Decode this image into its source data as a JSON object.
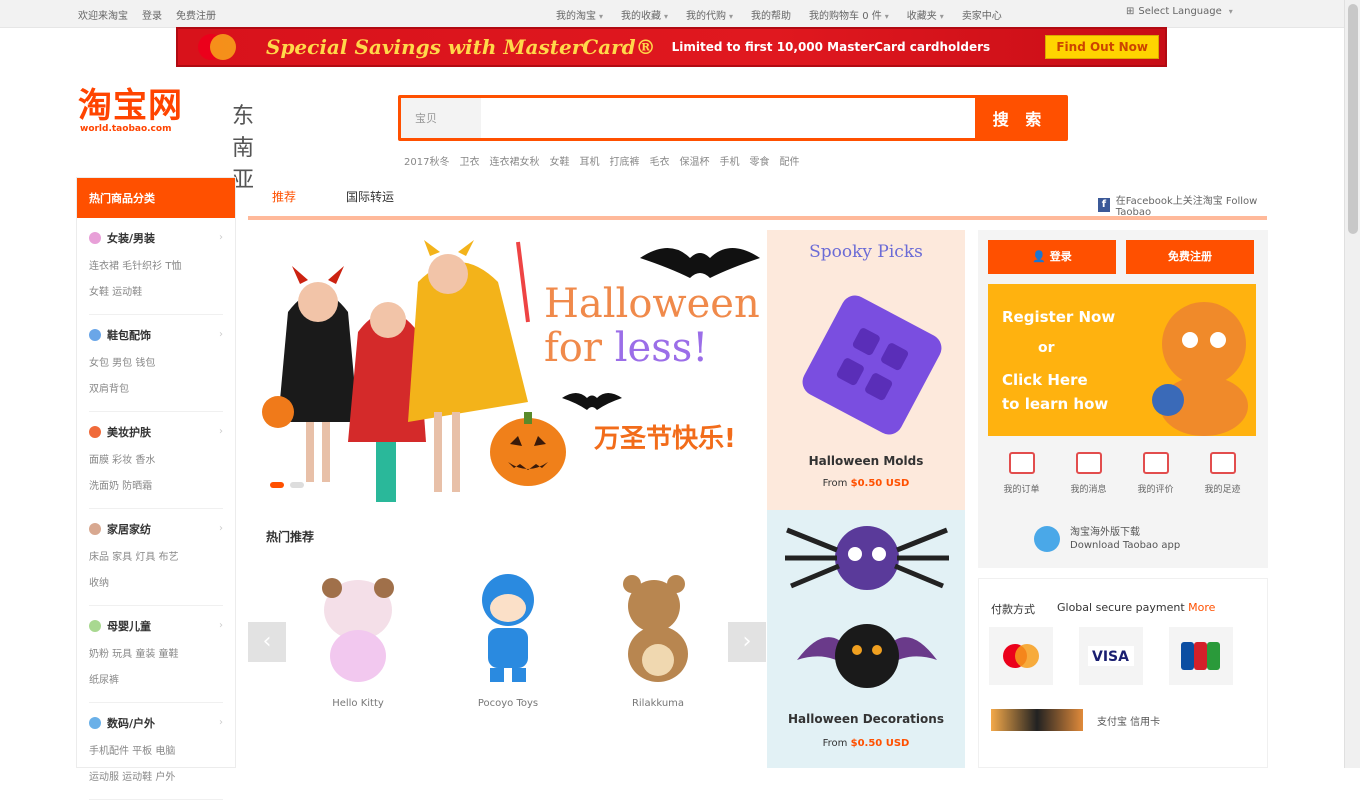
{
  "topbar": {
    "left_links": [
      "欢迎来淘宝",
      "登录",
      "免费注册"
    ],
    "right_links": [
      "我的淘宝",
      "我的收藏",
      "我的代购",
      "我的帮助",
      "我的购物车 0 件",
      "收藏夹"
    ],
    "help_link": "卖家中心",
    "language": "Select Language"
  },
  "banner": {
    "headline": "Special Savings with MasterCard®",
    "sub": "Limited to first 10,000 MasterCard cardholders",
    "cta": "Find Out Now"
  },
  "logo": {
    "main": "淘宝网",
    "url": "world.taobao.com",
    "region": "东南亚"
  },
  "search": {
    "category": "宝贝",
    "placeholder": "",
    "button": "搜 索",
    "hotwords": [
      "2017秋冬",
      "卫衣",
      "连衣裙女秋",
      "女鞋",
      "耳机",
      "打底裤",
      "毛衣",
      "保温杯",
      "手机",
      "零食",
      "配件"
    ]
  },
  "categories": {
    "header": "热门商品分类",
    "groups": [
      {
        "title": "女装/男装",
        "color": "#e8a0d8",
        "subs": [
          "连衣裙 毛针织衫 T恤",
          "女鞋 运动鞋"
        ]
      },
      {
        "title": "鞋包配饰",
        "color": "#6aa6e8",
        "subs": [
          "女包 男包 钱包",
          "双肩背包"
        ]
      },
      {
        "title": "美妆护肤",
        "color": "#f06a3a",
        "subs": [
          "面膜 彩妆 香水",
          "洗面奶 防晒霜"
        ]
      },
      {
        "title": "家居家纺",
        "color": "#d8a890",
        "subs": [
          "床品 家具 灯具 布艺",
          "收纳"
        ]
      },
      {
        "title": "母婴儿童",
        "color": "#a8d890",
        "subs": [
          "奶粉 玩具 童装 童鞋",
          "纸尿裤"
        ]
      },
      {
        "title": "数码/户外",
        "color": "#6ab0e8",
        "subs": [
          "手机配件 平板 电脑",
          "运动服 运动鞋 户外"
        ]
      }
    ]
  },
  "tabs": {
    "active": "推荐",
    "other": "国际转运",
    "facebook": "在Facebook上关注淘宝 Follow Taobao"
  },
  "hero": {
    "title_line1": "Halloween",
    "title_for": "for ",
    "title_less": "less!",
    "cn": "万圣节快乐!"
  },
  "hot_section": {
    "title": "热门推荐"
  },
  "products": [
    {
      "name": "Hello Kitty"
    },
    {
      "name": "Pocoyo Toys"
    },
    {
      "name": "Rilakkuma"
    }
  ],
  "promos": [
    {
      "title": "Spooky Picks",
      "name": "Halloween Molds",
      "price_prefix": "From ",
      "price": "$0.50 USD"
    },
    {
      "name": "Halloween Decorations",
      "price_prefix": "From ",
      "price": "$0.50 USD"
    }
  ],
  "side": {
    "login": "登录",
    "register": "免费注册",
    "reg_l1": "Register Now",
    "reg_l2": "or",
    "reg_l3": "Click Here",
    "reg_l4": "to learn how",
    "quick": [
      "我的订单",
      "我的消息",
      "我的评价",
      "我的足迹"
    ],
    "app_l1": "淘宝海外版下载",
    "app_l2": "Download Taobao app"
  },
  "pay": {
    "title": "付款方式",
    "desc": "Global secure payment",
    "more": "More",
    "footer_text": "支付宝 信用卡"
  }
}
